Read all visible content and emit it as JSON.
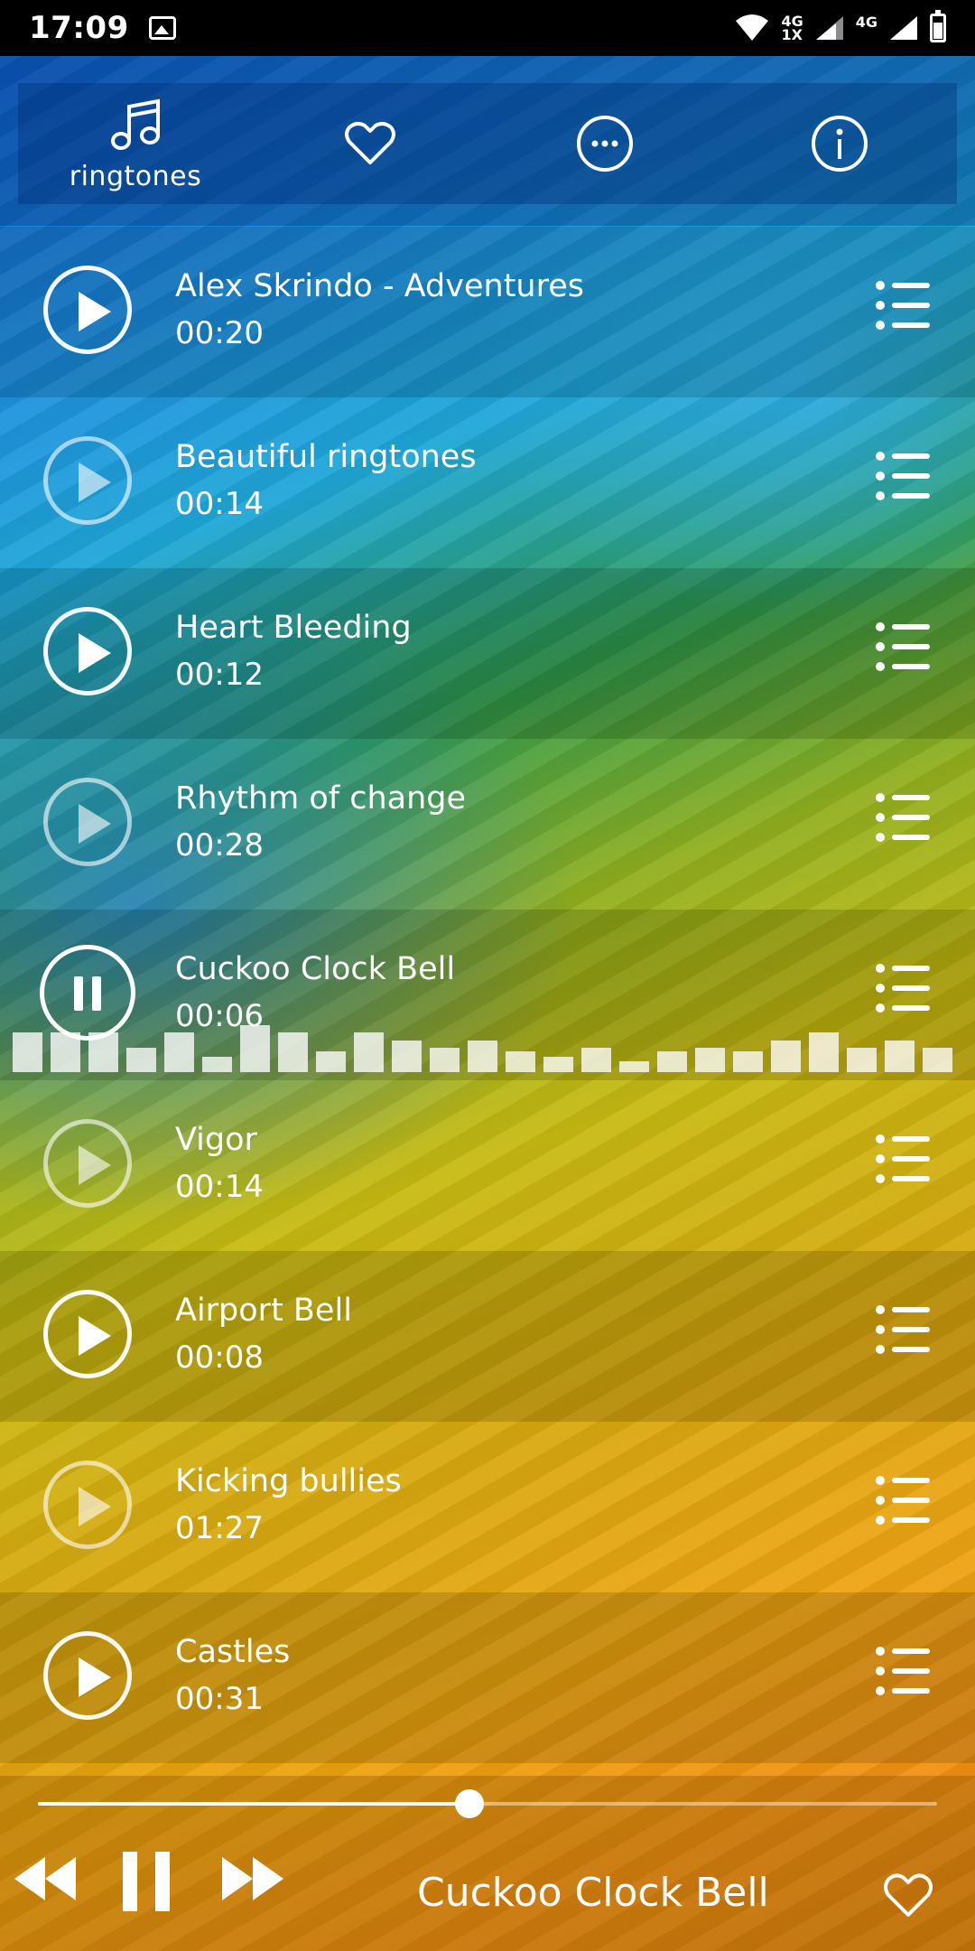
{
  "status_bar": {
    "time": "17:09",
    "net1_top": "4G",
    "net1_bottom": "1X",
    "net2": "4G"
  },
  "tabs": [
    {
      "name": "ringtones",
      "label": "ringtones",
      "icon": "music-note-icon"
    },
    {
      "name": "favorites",
      "label": "",
      "icon": "heart-icon"
    },
    {
      "name": "more",
      "label": "",
      "icon": "more-dots-icon"
    },
    {
      "name": "info",
      "label": "",
      "icon": "info-icon"
    }
  ],
  "songs": [
    {
      "title": "Alex Skrindo - Adventures",
      "duration": "00:20",
      "state": "play"
    },
    {
      "title": "Beautiful ringtones",
      "duration": "00:14",
      "state": "play"
    },
    {
      "title": "Heart Bleeding",
      "duration": "00:12",
      "state": "play"
    },
    {
      "title": "Rhythm of change",
      "duration": "00:28",
      "state": "play"
    },
    {
      "title": "Cuckoo Clock Bell",
      "duration": "00:06",
      "state": "playing"
    },
    {
      "title": "Vigor",
      "duration": "00:14",
      "state": "play"
    },
    {
      "title": "Airport Bell",
      "duration": "00:08",
      "state": "play"
    },
    {
      "title": "Kicking bullies",
      "duration": "01:27",
      "state": "play"
    },
    {
      "title": "Castles",
      "duration": "00:31",
      "state": "play"
    }
  ],
  "equalizer_levels": [
    0.58,
    0.58,
    0.58,
    0.35,
    0.58,
    0.22,
    0.68,
    0.58,
    0.3,
    0.58,
    0.46,
    0.35,
    0.46,
    0.3,
    0.22,
    0.35,
    0.16,
    0.3,
    0.35,
    0.3,
    0.46,
    0.58,
    0.35,
    0.46,
    0.35
  ],
  "player": {
    "now_playing": "Cuckoo Clock Bell",
    "progress": 0.48
  },
  "colors": {
    "accent": "#ffffff",
    "top_gradient": "#0d5fd8",
    "bottom_gradient": "#f19013"
  }
}
